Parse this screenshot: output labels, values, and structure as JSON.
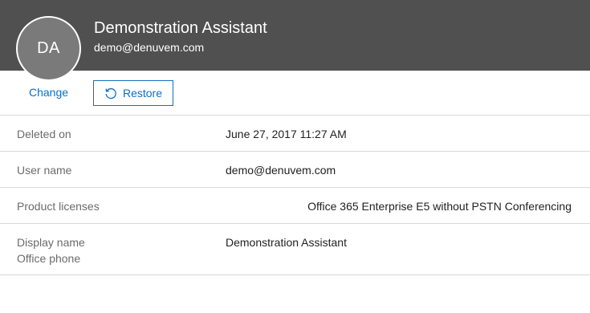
{
  "header": {
    "avatar_initials": "DA",
    "display_name": "Demonstration Assistant",
    "email": "demo@denuvem.com",
    "background_color": "#505050"
  },
  "actions": {
    "change_label": "Change",
    "restore_label": "Restore",
    "restore_icon": "restore-icon",
    "accent_color": "#106ebe"
  },
  "details": {
    "deleted_on": {
      "label": "Deleted on",
      "value": "June 27, 2017 11:27 AM"
    },
    "user_name": {
      "label": "User name",
      "value": "demo@denuvem.com"
    },
    "product_licenses": {
      "label": "Product licenses",
      "value": "Office 365 Enterprise E5 without PSTN Conferencing"
    },
    "display_name": {
      "label": "Display name",
      "value": "Demonstration Assistant"
    },
    "office_phone": {
      "label": "Office phone"
    }
  }
}
